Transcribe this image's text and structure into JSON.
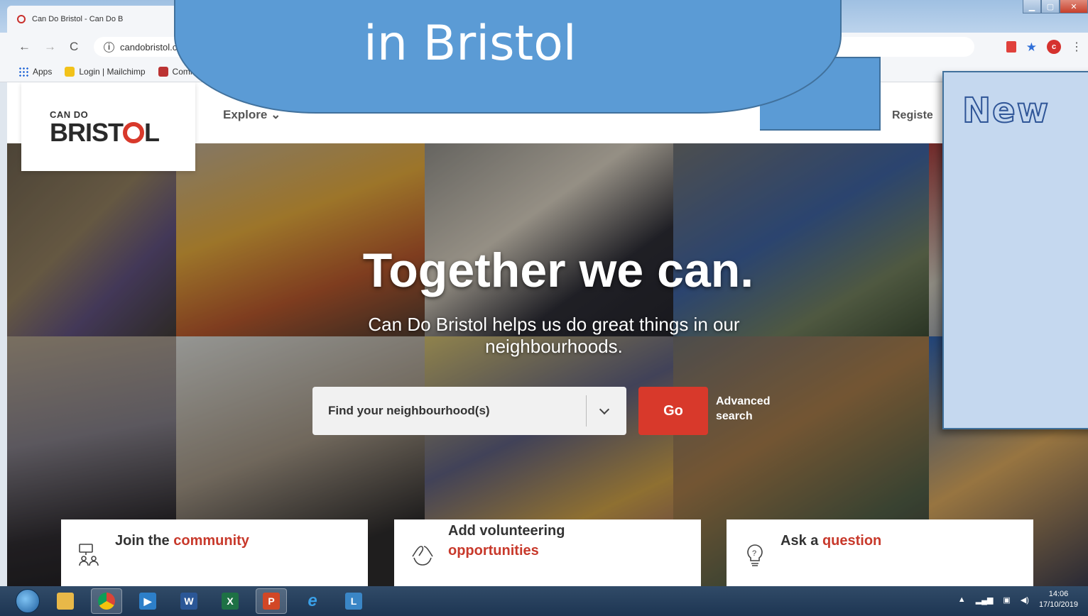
{
  "browser": {
    "tab_title": "Can Do Bristol - Can Do B",
    "url": "candobristol.c",
    "profile_initial": "c",
    "bookmarks": [
      "Apps",
      "Login | Mailchimp",
      "Commun"
    ]
  },
  "site": {
    "logo_small": "CAN DO",
    "logo_big_left": "BRIST",
    "logo_big_right": "L",
    "nav_explore": "Explore",
    "nav_register": "Registe"
  },
  "hero": {
    "title": "Together we can.",
    "subtitle": "Can Do Bristol helps us do great things in our neighbourhoods.",
    "search_placeholder": "Find your neighbourhood(s)",
    "go_label": "Go",
    "advanced_line1": "Advanced",
    "advanced_line2": "search"
  },
  "cards": [
    {
      "prefix": "Join the ",
      "highlight": "community"
    },
    {
      "prefix": "Add volunteering",
      "highlight": "opportunities"
    },
    {
      "prefix": "Ask a ",
      "highlight": "question"
    }
  ],
  "overlays": {
    "bubble_text": "in Bristol",
    "box_text": "New"
  },
  "taskbar": {
    "time": "14:06",
    "date": "17/10/2019"
  },
  "colors": {
    "brand_red": "#d8392b",
    "callout_blue": "#5b9bd5",
    "box_blue": "#c5d8ef"
  }
}
